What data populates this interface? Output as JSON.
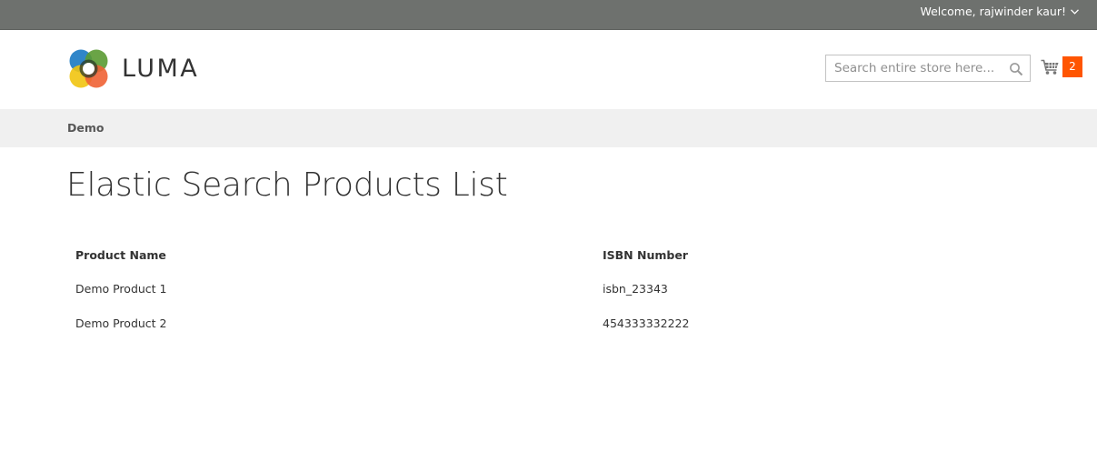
{
  "topbar": {
    "welcome_text": "Welcome, rajwinder kaur!",
    "dropdown_icon": "chevron-down-icon"
  },
  "header": {
    "logo_text": "LUMA",
    "search": {
      "placeholder": "Search entire store here...",
      "value": "",
      "icon": "search-icon"
    },
    "cart": {
      "icon": "cart-icon",
      "count": "2",
      "badge_color": "#ff5501"
    }
  },
  "nav": {
    "items": [
      {
        "label": "Demo"
      }
    ]
  },
  "main": {
    "title": "Elastic Search Products List",
    "table": {
      "columns": [
        "Product Name",
        "ISBN Number"
      ],
      "rows": [
        [
          "Demo Product 1",
          "isbn_23343"
        ],
        [
          "Demo Product 2",
          "454333332222"
        ]
      ]
    }
  },
  "colors": {
    "topbar_bg": "#6e716e",
    "nav_bg": "#f0f0f0",
    "accent": "#ff5501"
  }
}
